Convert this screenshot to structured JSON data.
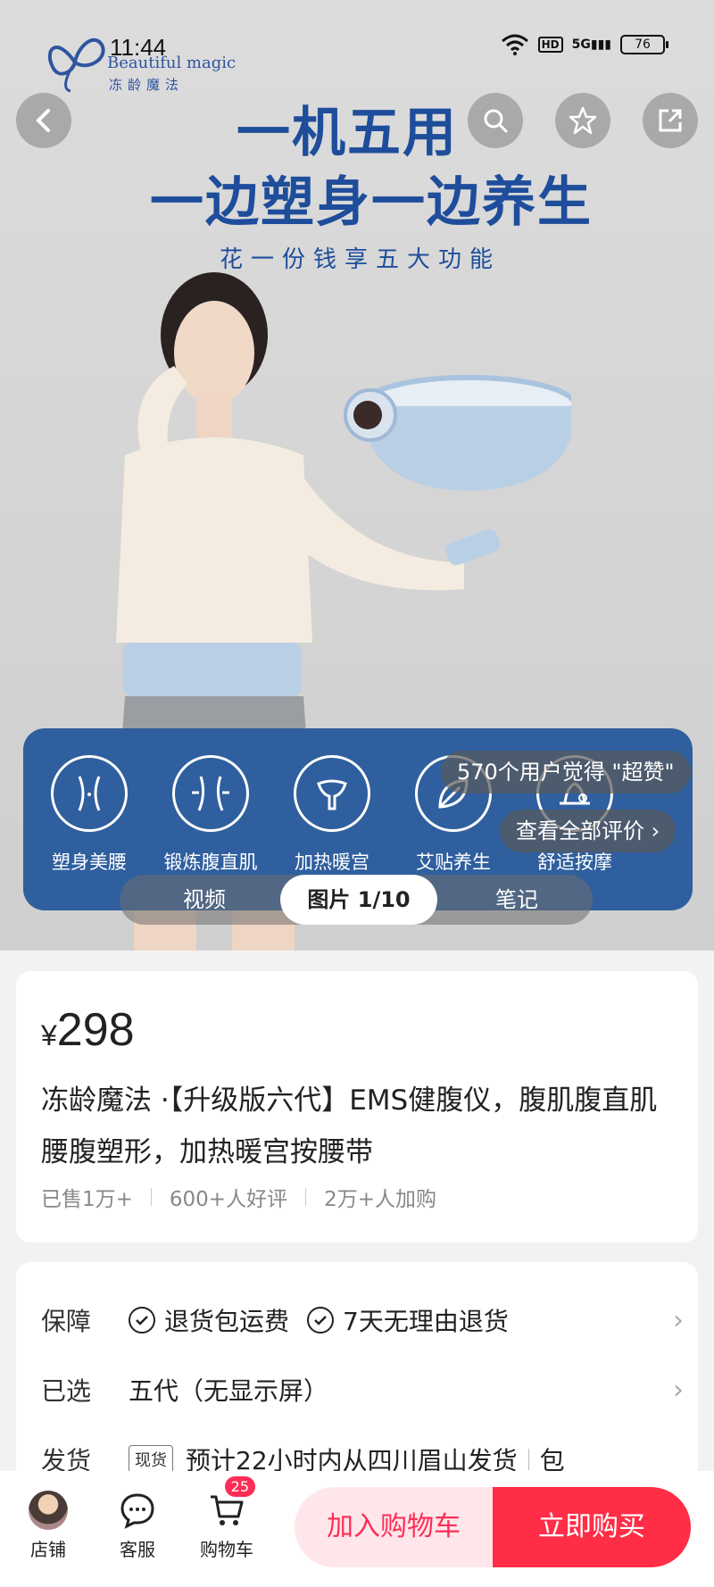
{
  "status": {
    "time": "11:44",
    "hd": "HD",
    "signal": "5G",
    "battery": "76"
  },
  "brand": {
    "en": "Beautiful magic",
    "cn": "冻龄魔法"
  },
  "hero": {
    "headline1": "一机五用",
    "headline2": "一边塑身一边养生",
    "headline3": "花一份钱享五大功能"
  },
  "features": [
    {
      "label": "塑身美腰",
      "icon": "waist-icon"
    },
    {
      "label": "锻炼腹直肌",
      "icon": "abs-icon"
    },
    {
      "label": "加热暖宫",
      "icon": "uterus-icon"
    },
    {
      "label": "艾贴养生",
      "icon": "leaf-icon"
    },
    {
      "label": "舒适按摩",
      "icon": "massage-icon"
    }
  ],
  "reviews": {
    "summary_prefix": "570个用户觉得 ",
    "summary_quote": "\"超赞\"",
    "view_all": "查看全部评价"
  },
  "media_tabs": {
    "video": "视频",
    "picture": "图片 1/10",
    "note": "笔记"
  },
  "product": {
    "currency": "¥",
    "price": "298",
    "title": "冻龄魔法 ·【升级版六代】EMS健腹仪，腹肌腹直肌腰腹塑形，加热暖宫按腰带",
    "sold": "已售1万+",
    "good_reviews": "600+人好评",
    "carts": "2万+人加购"
  },
  "info": {
    "guarantee_label": "保障",
    "guarantee_1": "退货包运费",
    "guarantee_2": "7天无理由退货",
    "selected_label": "已选",
    "selected_value": "五代（无显示屏）",
    "ship_label": "发货",
    "ship_tag": "现货",
    "ship_text": "预计22小时内从四川眉山发货",
    "ship_extra": "包"
  },
  "bottom": {
    "store": "店铺",
    "service": "客服",
    "cart": "购物车",
    "cart_count": "25",
    "add_to_cart": "加入购物车",
    "buy_now": "立即购买"
  },
  "colors": {
    "brand_blue": "#1e4d9b",
    "accent_red": "#ff2d46",
    "feature_panel": "#2f5f9e"
  }
}
